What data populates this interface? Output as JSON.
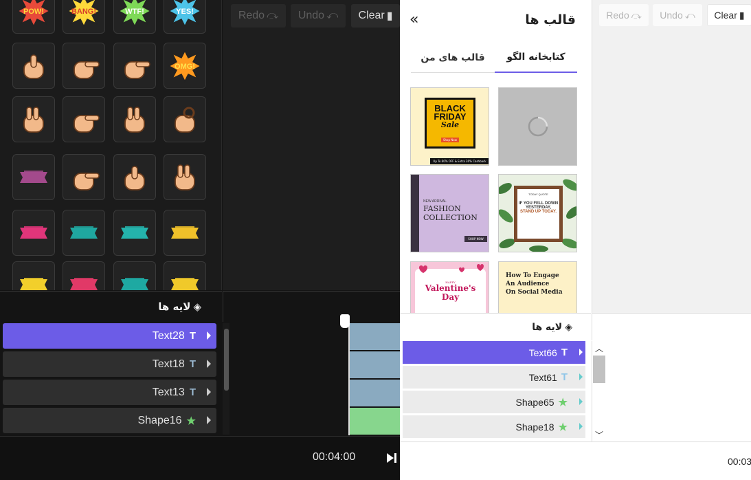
{
  "dark_editor": {
    "stickers": [
      {
        "name": "pow-sticker",
        "text": "POW!"
      },
      {
        "name": "bang-sticker",
        "text": "BANG!"
      },
      {
        "name": "wtf-sticker",
        "text": "WTF!"
      },
      {
        "name": "yes-sticker",
        "text": "YES!"
      },
      {
        "name": "thumbs-up-hand-sticker"
      },
      {
        "name": "pointing-hand-sticker"
      },
      {
        "name": "pointing-finger-hand-sticker"
      },
      {
        "name": "omg-sticker",
        "text": "OMG!"
      },
      {
        "name": "peace-hand-sticker"
      },
      {
        "name": "gun-hand-sticker"
      },
      {
        "name": "rock-hand-sticker"
      },
      {
        "name": "ok-hand-sticker"
      },
      {
        "name": "purple-ribbon-sticker"
      },
      {
        "name": "point-hand-sticker"
      },
      {
        "name": "fist-sticker"
      },
      {
        "name": "victory-hand-sticker"
      },
      {
        "name": "pink-banner-sticker"
      },
      {
        "name": "teal-banner-sticker"
      },
      {
        "name": "teal-ribbon-sticker"
      },
      {
        "name": "yellow-banner-sticker"
      },
      {
        "name": "yellow-stack-sticker"
      },
      {
        "name": "red-ribbon-sticker"
      },
      {
        "name": "teal-wide-ribbon-sticker"
      },
      {
        "name": "yellow-scroll-sticker"
      }
    ],
    "toolbar": {
      "redo": "Redo",
      "undo": "Undo",
      "clear": "Clear"
    },
    "layers_title": "لایه ها",
    "layers": [
      {
        "label": "Text28",
        "type": "T",
        "active": true
      },
      {
        "label": "Text18",
        "type": "T",
        "active": false
      },
      {
        "label": "Text13",
        "type": "T",
        "active": false
      },
      {
        "label": "Shape16",
        "type": "★",
        "active": false
      }
    ],
    "time": "00:04:00"
  },
  "light_editor": {
    "panel_title": "قالب ها",
    "collapse_icon": "«",
    "tabs": {
      "library": "کتابخانه الگو",
      "mine": "قالب های من"
    },
    "templates": {
      "black_friday": {
        "line1": "BLACK",
        "line2": "FRIDAY",
        "line3": "Sale",
        "button": "Shop Now",
        "footer": "Up To 60% OFF & Extra 30% Cashback"
      },
      "fashion": {
        "small": "NEW ARRIVAL",
        "title1": "FASHION",
        "title2": "COLLECTION",
        "button": "SHOP NOW"
      },
      "quote": {
        "top": "TODAY QUOTE",
        "line1": "IF YOU FELL DOWN",
        "line2": "YESTERDAY,",
        "line3": "STAND UP TODAY."
      },
      "valentine": {
        "small": "HAPPY",
        "title1": "Valentine's",
        "title2": "Day"
      },
      "social": {
        "line1": "How To Engage",
        "line2": "An Audience",
        "line3": "On Social Media"
      }
    },
    "toolbar": {
      "redo": "Redo",
      "undo": "Undo",
      "clear": "Clear"
    },
    "layers_title": "لایه ها",
    "layers": [
      {
        "label": "Text66",
        "type": "T",
        "active": true
      },
      {
        "label": "Text61",
        "type": "T",
        "active": false
      },
      {
        "label": "Shape65",
        "type": "★",
        "active": false
      },
      {
        "label": "Shape18",
        "type": "★",
        "active": false
      }
    ],
    "time": "00:03"
  },
  "colors": {
    "accent": "#6c5ce7",
    "shape_star": "#6fcf6f",
    "text_glyph_light": "#8ec5e8"
  }
}
